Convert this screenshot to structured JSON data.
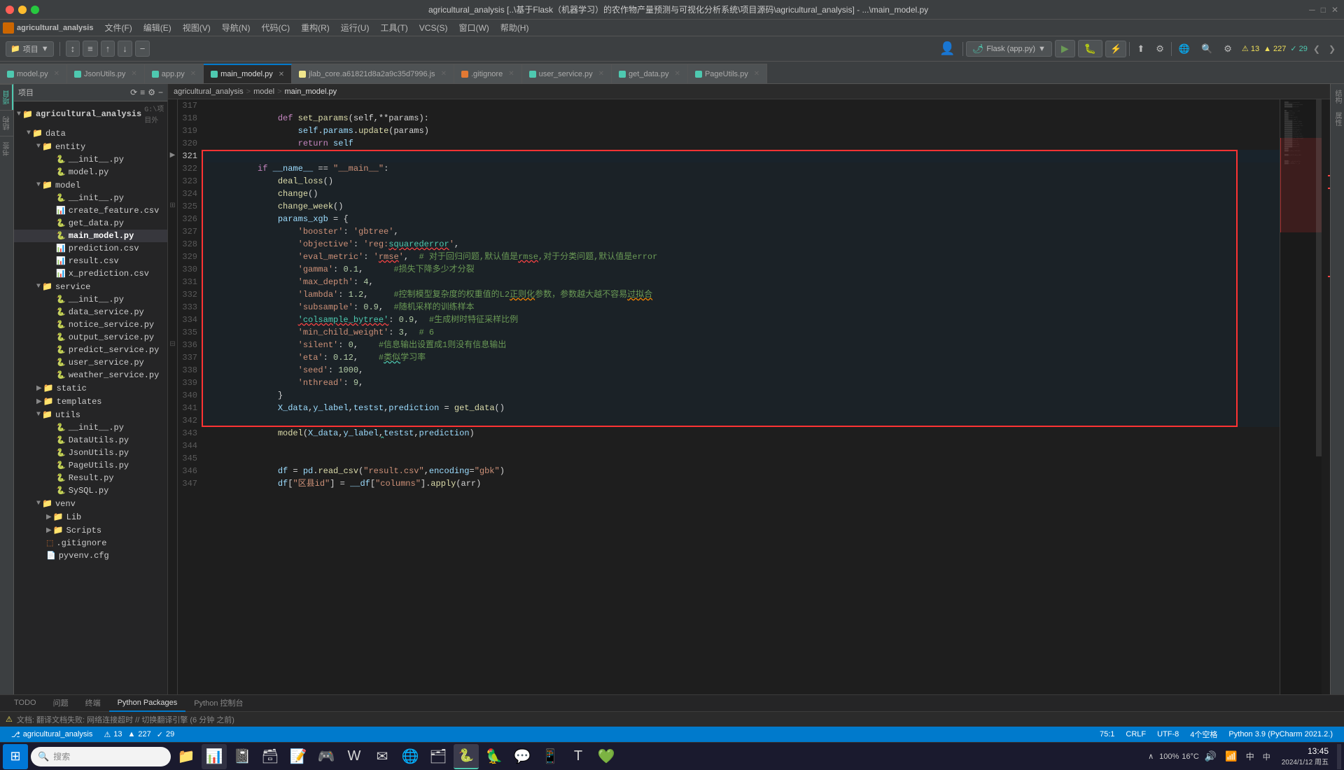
{
  "titlebar": {
    "title": "agricultural_analysis [..\\基于Flask（机器学习）的农作物产量预测与可视化分析系统\\项目源码\\agricultural_analysis] - ...\\main_model.py",
    "close": "✕",
    "minimize": "─",
    "maximize": "□"
  },
  "menubar": {
    "items": [
      "文件(F)",
      "编辑(E)",
      "视图(V)",
      "导航(N)",
      "代码(C)",
      "重构(R)",
      "运行(U)",
      "工具(T)",
      "VCS(S)",
      "窗口(W)",
      "帮助(H)"
    ]
  },
  "toolbar": {
    "project_label": "项目",
    "flask_label": "Flask (app.py)",
    "run_label": "▶",
    "debug_label": "🐛"
  },
  "tabs": [
    {
      "label": "model.py",
      "active": false,
      "type": "py"
    },
    {
      "label": "JsonUtils.py",
      "active": false,
      "type": "py"
    },
    {
      "label": "app.py",
      "active": false,
      "type": "py"
    },
    {
      "label": "main_model.py",
      "active": true,
      "type": "py"
    },
    {
      "label": "jlab_core.a61821d8a2a9c35d7996.js",
      "active": false,
      "type": "js"
    },
    {
      "label": ".gitignore",
      "active": false,
      "type": "git"
    },
    {
      "label": "user_service.py",
      "active": false,
      "type": "py"
    },
    {
      "label": "get_data.py",
      "active": false,
      "type": "py"
    },
    {
      "label": "PageUtils.py",
      "active": false,
      "type": "py"
    }
  ],
  "breadcrumb": {
    "project": "agricultural_analysis",
    "sep1": ">",
    "model": "model",
    "sep2": ">",
    "file": "main_model.py"
  },
  "sidebar": {
    "title": "项目",
    "root": "agricultural_analysis",
    "root_path": "G:\\项目外",
    "tree": [
      {
        "indent": 1,
        "type": "folder",
        "label": "data",
        "expanded": true
      },
      {
        "indent": 2,
        "type": "folder",
        "label": "entity",
        "expanded": true
      },
      {
        "indent": 3,
        "type": "file",
        "label": "__init__.py",
        "ext": "py"
      },
      {
        "indent": 3,
        "type": "file",
        "label": "model.py",
        "ext": "py"
      },
      {
        "indent": 2,
        "type": "folder",
        "label": "model",
        "expanded": true
      },
      {
        "indent": 3,
        "type": "file",
        "label": "__init__.py",
        "ext": "py"
      },
      {
        "indent": 3,
        "type": "file",
        "label": "create_feature.csv",
        "ext": "csv"
      },
      {
        "indent": 3,
        "type": "file",
        "label": "get_data.py",
        "ext": "py"
      },
      {
        "indent": 3,
        "type": "file",
        "label": "main_model.py",
        "ext": "py",
        "selected": true
      },
      {
        "indent": 3,
        "type": "file",
        "label": "prediction.csv",
        "ext": "csv"
      },
      {
        "indent": 3,
        "type": "file",
        "label": "result.csv",
        "ext": "csv"
      },
      {
        "indent": 3,
        "type": "file",
        "label": "x_prediction.csv",
        "ext": "csv"
      },
      {
        "indent": 2,
        "type": "folder",
        "label": "service",
        "expanded": true
      },
      {
        "indent": 3,
        "type": "file",
        "label": "__init__.py",
        "ext": "py"
      },
      {
        "indent": 3,
        "type": "file",
        "label": "data_service.py",
        "ext": "py"
      },
      {
        "indent": 3,
        "type": "file",
        "label": "notice_service.py",
        "ext": "py"
      },
      {
        "indent": 3,
        "type": "file",
        "label": "output_service.py",
        "ext": "py"
      },
      {
        "indent": 3,
        "type": "file",
        "label": "predict_service.py",
        "ext": "py"
      },
      {
        "indent": 3,
        "type": "file",
        "label": "user_service.py",
        "ext": "py"
      },
      {
        "indent": 3,
        "type": "file",
        "label": "weather_service.py",
        "ext": "py"
      },
      {
        "indent": 2,
        "type": "folder",
        "label": "static",
        "expanded": false
      },
      {
        "indent": 2,
        "type": "folder",
        "label": "templates",
        "expanded": false
      },
      {
        "indent": 2,
        "type": "folder",
        "label": "utils",
        "expanded": true
      },
      {
        "indent": 3,
        "type": "file",
        "label": "__init__.py",
        "ext": "py"
      },
      {
        "indent": 3,
        "type": "file",
        "label": "DataUtils.py",
        "ext": "py"
      },
      {
        "indent": 3,
        "type": "file",
        "label": "JsonUtils.py",
        "ext": "py"
      },
      {
        "indent": 3,
        "type": "file",
        "label": "PageUtils.py",
        "ext": "py"
      },
      {
        "indent": 3,
        "type": "file",
        "label": "Result.py",
        "ext": "py"
      },
      {
        "indent": 3,
        "type": "file",
        "label": "SySQL.py",
        "ext": "py"
      },
      {
        "indent": 2,
        "type": "folder",
        "label": "venv",
        "expanded": true
      },
      {
        "indent": 3,
        "type": "folder",
        "label": "Lib",
        "expanded": false
      },
      {
        "indent": 3,
        "type": "folder",
        "label": "Scripts",
        "expanded": false
      },
      {
        "indent": 2,
        "type": "file",
        "label": ".gitignore",
        "ext": "git"
      },
      {
        "indent": 2,
        "type": "file",
        "label": "pyvenv.cfg",
        "ext": "cfg"
      }
    ]
  },
  "code": {
    "lines": [
      {
        "num": 317,
        "content": "    def set_params(self,**params):"
      },
      {
        "num": 318,
        "content": "        self.params.update(params)"
      },
      {
        "num": 319,
        "content": "        return self"
      },
      {
        "num": 320,
        "content": ""
      },
      {
        "num": 321,
        "content": "if __name__ == \"__main__\":",
        "highlighted": true,
        "runnable": true
      },
      {
        "num": 322,
        "content": "    deal_loss()",
        "highlighted": true
      },
      {
        "num": 323,
        "content": "    change()",
        "highlighted": true
      },
      {
        "num": 324,
        "content": "    change_week()",
        "highlighted": true
      },
      {
        "num": 325,
        "content": "    params_xgb = {",
        "highlighted": true
      },
      {
        "num": 326,
        "content": "        'booster': 'gbtree',",
        "highlighted": true
      },
      {
        "num": 327,
        "content": "        'objective': 'reg:squarederror',",
        "highlighted": true
      },
      {
        "num": 328,
        "content": "        'eval_metric': 'rmse',  # 对于回归问题,默认值是rmse,对于分类问题,默认值是error",
        "highlighted": true
      },
      {
        "num": 329,
        "content": "        'gamma': 0.1,      #损失下降多少才分裂",
        "highlighted": true
      },
      {
        "num": 330,
        "content": "        'max_depth': 4,",
        "highlighted": true
      },
      {
        "num": 331,
        "content": "        'lambda': 1.2,     #控制模型复杂度的权重值的L2正则化参数，参数越大越不容易过拟合",
        "highlighted": true
      },
      {
        "num": 332,
        "content": "        'subsample': 0.9,  #随机采样的训练样本",
        "highlighted": true
      },
      {
        "num": 333,
        "content": "        'colsample_bytree': 0.9,  #生成树时特征采样比例",
        "highlighted": true
      },
      {
        "num": 334,
        "content": "        'min_child_weight': 3,  # 6",
        "highlighted": true
      },
      {
        "num": 335,
        "content": "        'silent': 0,    #信息输出设置成1则没有信息输出",
        "highlighted": true
      },
      {
        "num": 336,
        "content": "        'eta': 0.12,    #类似学习率",
        "highlighted": true
      },
      {
        "num": 337,
        "content": "        'seed': 1000,",
        "highlighted": true
      },
      {
        "num": 338,
        "content": "        'nthread': 9,",
        "highlighted": true
      },
      {
        "num": 339,
        "content": "    }",
        "highlighted": true
      },
      {
        "num": 340,
        "content": "    X_data,y_label,testst,prediction = get_data()",
        "highlighted": true
      },
      {
        "num": 341,
        "content": "",
        "highlighted": true
      },
      {
        "num": 342,
        "content": "    model(X_data,y_label,testst,prediction)",
        "highlighted": true
      },
      {
        "num": 343,
        "content": "",
        "highlighted": false
      },
      {
        "num": 344,
        "content": ""
      },
      {
        "num": 345,
        "content": "    df = pd.read_csv(\"result.csv\",encoding=\"gbk\")"
      },
      {
        "num": 346,
        "content": "    df[\"区县id\"] = __df[\"columns\"].apply(arr)"
      },
      {
        "num": 347,
        "content": ""
      }
    ]
  },
  "warnings": {
    "errors": "⚠ 13",
    "warnings": "▲ 227",
    "info": "✓ 29"
  },
  "statusbar": {
    "git": "agricultural_analysis",
    "model": "model",
    "file": "main_model.py",
    "position": "75:1",
    "encoding": "CRLF",
    "charset": "UTF-8",
    "indent": "4个空格",
    "lang": "Python 3.9 (PyCharm 2021.2.)",
    "errors_label": "⚠ 13  ▲ 227  ✓ 29"
  },
  "bottom_tabs": {
    "items": [
      "TODO",
      "问题",
      "终端",
      "Python Packages",
      "Python 控制台"
    ]
  },
  "bottom_status": {
    "translate_msg": "文档: 翻译文档失败: 网络连接超时 // 切换翻译引擎 (6 分钟 之前)"
  },
  "taskbar": {
    "search_placeholder": "搜索",
    "clock_time": "13:45",
    "clock_date": "2024/1/12 周五",
    "battery": "100%",
    "temp": "16°C",
    "lang": "中"
  }
}
